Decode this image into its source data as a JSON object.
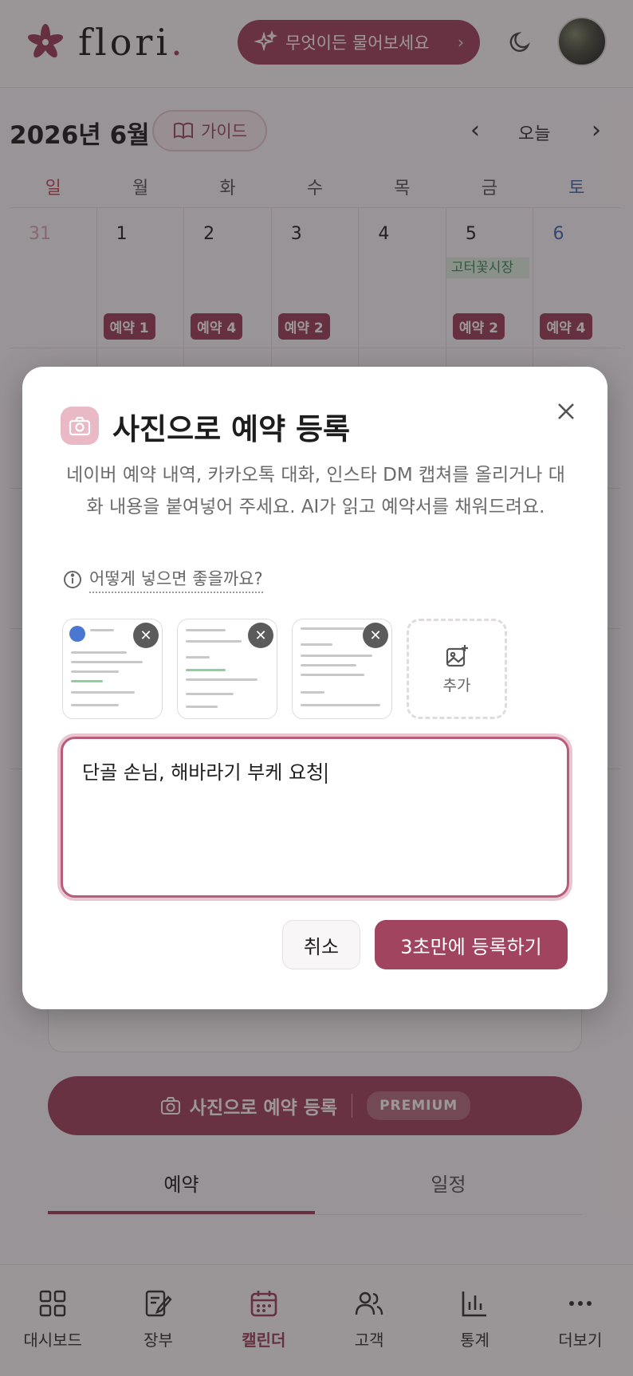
{
  "header": {
    "logo_text": "flori",
    "logo_dot": ".",
    "ask_label": "무엇이든 물어보세요",
    "ask_chevron": "›"
  },
  "calendar": {
    "month_title": "2026년 6월",
    "guide_label": "가이드",
    "today_label": "오늘",
    "prev": "‹",
    "next": "›",
    "weekdays": [
      "일",
      "월",
      "화",
      "수",
      "목",
      "금",
      "토"
    ],
    "week1": {
      "days": [
        "31",
        "1",
        "2",
        "3",
        "4",
        "5",
        "6"
      ],
      "badges": [
        "",
        "예약 1",
        "예약 4",
        "예약 2",
        "",
        "예약 2",
        "예약 4"
      ],
      "event_fri": "고터꽃시장"
    }
  },
  "background": {
    "photo_reg_label": "사진으로 예약 등록",
    "premium_label": "PREMIUM",
    "tab_reservation": "예약",
    "tab_schedule": "일정"
  },
  "bottom_nav": {
    "items": [
      {
        "label": "대시보드"
      },
      {
        "label": "장부"
      },
      {
        "label": "캘린더"
      },
      {
        "label": "고객"
      },
      {
        "label": "통계"
      },
      {
        "label": "더보기"
      }
    ]
  },
  "modal": {
    "title": "사진으로 예약 등록",
    "description": "네이버 예약 내역, 카카오톡 대화, 인스타 DM 캡쳐를 올리거나 대화 내용을 붙여넣어 주세요. AI가 읽고 예약서를 채워드려요.",
    "help_link": "어떻게 넣으면 좋을까요?",
    "add_label": "추가",
    "remove_symbol": "✕",
    "text_value": "단골 손님, 해바라기 부케 요청",
    "cancel_label": "취소",
    "submit_label": "3초만에 등록하기"
  },
  "colors": {
    "brand": "#a0445f",
    "sunday": "#c84a5a",
    "saturday": "#3b6bb8"
  }
}
